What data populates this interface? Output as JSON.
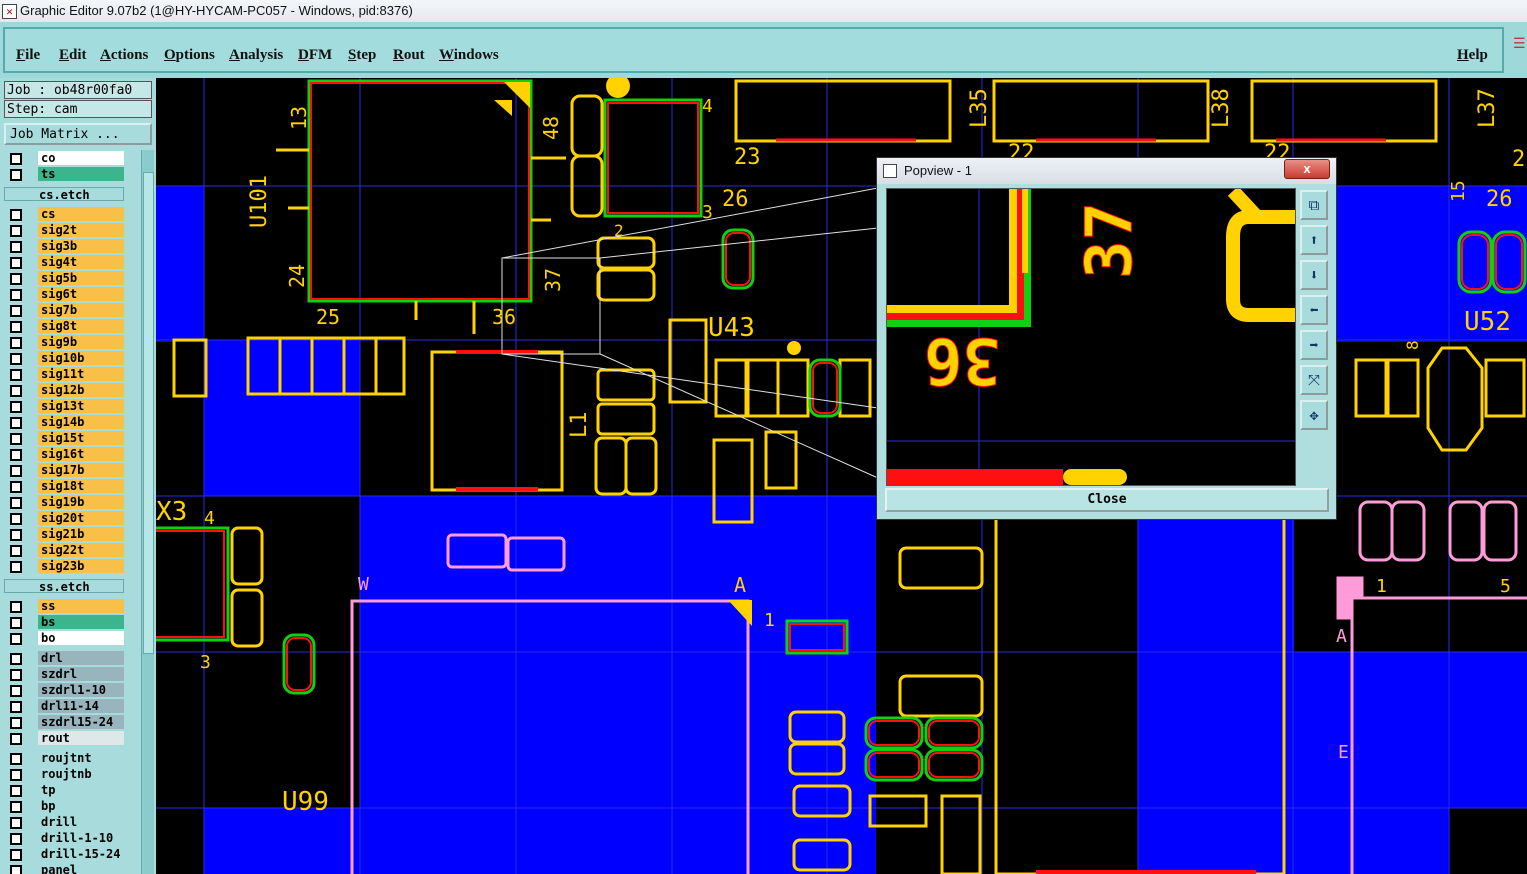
{
  "window": {
    "title": "Graphic Editor 9.07b2 (1@HY-HYCAM-PC057 - Windows, pid:8376)"
  },
  "menu": {
    "items": [
      "File",
      "Edit",
      "Actions",
      "Options",
      "Analysis",
      "DFM",
      "Step",
      "Rout",
      "Windows"
    ],
    "help": "Help"
  },
  "panel": {
    "job": "Job : ob48r00fa0",
    "step": "Step: cam",
    "job_matrix": "Job Matrix ...",
    "layers": [
      {
        "name": "co",
        "color": "#ffffff"
      },
      {
        "name": "ts",
        "color": "#3cb48c"
      },
      {
        "name": "cs.etch",
        "color": "#a8dcdc"
      },
      {
        "name": "cs",
        "color": "#f8c048"
      },
      {
        "name": "sig2t",
        "color": "#f8c048"
      },
      {
        "name": "sig3b",
        "color": "#f8c048"
      },
      {
        "name": "sig4t",
        "color": "#f8c048"
      },
      {
        "name": "sig5b",
        "color": "#f8c048"
      },
      {
        "name": "sig6t",
        "color": "#f8c048"
      },
      {
        "name": "sig7b",
        "color": "#f8c048"
      },
      {
        "name": "sig8t",
        "color": "#f8c048"
      },
      {
        "name": "sig9b",
        "color": "#f8c048"
      },
      {
        "name": "sig10b",
        "color": "#f8c048"
      },
      {
        "name": "sig11t",
        "color": "#f8c048"
      },
      {
        "name": "sig12b",
        "color": "#f8c048"
      },
      {
        "name": "sig13t",
        "color": "#f8c048"
      },
      {
        "name": "sig14b",
        "color": "#f8c048"
      },
      {
        "name": "sig15t",
        "color": "#f8c048"
      },
      {
        "name": "sig16t",
        "color": "#f8c048"
      },
      {
        "name": "sig17b",
        "color": "#f8c048"
      },
      {
        "name": "sig18t",
        "color": "#f8c048"
      },
      {
        "name": "sig19b",
        "color": "#f8c048"
      },
      {
        "name": "sig20t",
        "color": "#f8c048"
      },
      {
        "name": "sig21b",
        "color": "#f8c048"
      },
      {
        "name": "sig22t",
        "color": "#f8c048"
      },
      {
        "name": "sig23b",
        "color": "#f8c048"
      },
      {
        "name": "ss.etch",
        "color": "#a8dcdc"
      },
      {
        "name": "ss",
        "color": "#f8c048"
      },
      {
        "name": "bs",
        "color": "#3cb48c"
      },
      {
        "name": "bo",
        "color": "#ffffff"
      },
      {
        "name": "drl",
        "color": "#98b4bc"
      },
      {
        "name": "szdrl",
        "color": "#98b4bc"
      },
      {
        "name": "szdrl1-10",
        "color": "#98b4bc"
      },
      {
        "name": "drl11-14",
        "color": "#98b4bc"
      },
      {
        "name": "szdrl15-24",
        "color": "#98b4bc"
      },
      {
        "name": "rout",
        "color": "#dfe8e8"
      },
      {
        "name": "roujtnt",
        "color": "#a8dcdc"
      },
      {
        "name": "roujtnb",
        "color": "#a8dcdc"
      },
      {
        "name": "tp",
        "color": "#a8dcdc"
      },
      {
        "name": "bp",
        "color": "#a8dcdc"
      },
      {
        "name": "drill",
        "color": "#a8dcdc"
      },
      {
        "name": "drill-1-10",
        "color": "#a8dcdc"
      },
      {
        "name": "drill-15-24",
        "color": "#a8dcdc"
      },
      {
        "name": "panel",
        "color": "#a8dcdc"
      }
    ]
  },
  "canvas_labels": {
    "u101": "U101",
    "n13": "13",
    "n48": "48",
    "n24": "24",
    "n37": "37",
    "n25": "25",
    "n36": "36",
    "n4": "4",
    "n3": "3",
    "n2": "2",
    "n23": "23",
    "n26": "26",
    "l35": "L35",
    "l38": "L38",
    "l37": "L37",
    "n22a": "22",
    "n22b": "22",
    "n2r": "2",
    "u43": "U43",
    "n15": "15",
    "n26r": "26",
    "u52": "U52",
    "n8": "8",
    "l1": "L1",
    "x3": "X3",
    "n4x": "4",
    "n3x": "3",
    "w": "W",
    "a": "A",
    "n1a": "1",
    "u99": "U99",
    "n1r": "1",
    "n5r": "5",
    "ar": "A",
    "er": "E"
  },
  "popview": {
    "title": "Popview - 1",
    "close_x": "x",
    "view_label_37": "37",
    "view_label_36": "36",
    "close_label": "Close",
    "tools": [
      "zoom-window-icon",
      "pan-up-icon",
      "pan-down-icon",
      "pan-left-icon",
      "pan-right-icon",
      "fit-icon",
      "center-icon"
    ]
  },
  "colors": {
    "board": "#0000ff",
    "pad": "#ffd200",
    "copper": "#ff1010",
    "mask": "#10d010",
    "outline": "#ff9bd8",
    "grid": "#2a2ae6"
  }
}
